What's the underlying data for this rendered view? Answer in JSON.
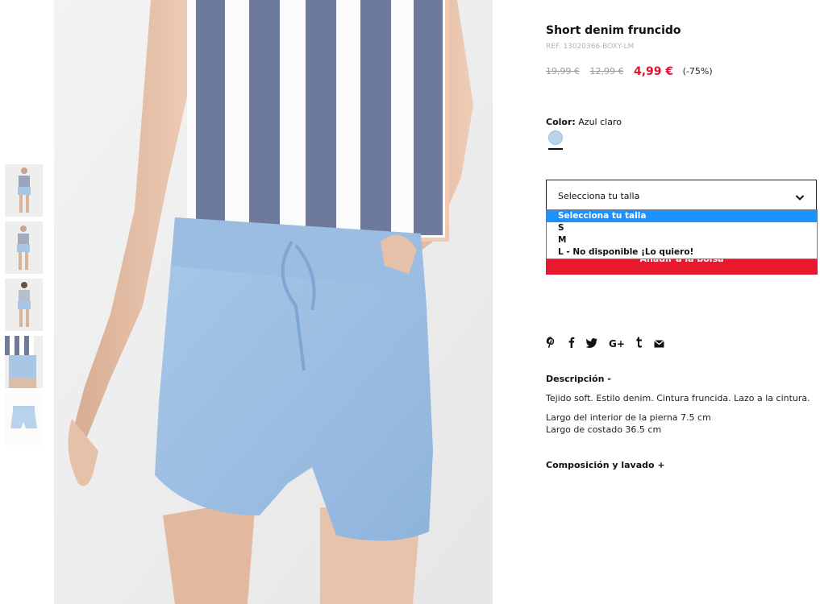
{
  "product": {
    "title": "Short denim fruncido",
    "ref": "REF. 13020366-BOXY-LM",
    "old_price_1": "19,99 €",
    "old_price_2": "12,99 €",
    "price": "4,99 €",
    "discount": "(-75%)"
  },
  "color": {
    "label": "Color:",
    "value": "Azul claro",
    "swatch": "#b8d4ec"
  },
  "size_select": {
    "selected": "Selecciona tu talla",
    "options": [
      "Selecciona tu talla",
      "S",
      "M",
      "L - No disponible ¡Lo quiero!"
    ]
  },
  "add_to_bag": "Añadir a la bolsa",
  "social": [
    "pinterest-icon",
    "facebook-icon",
    "twitter-icon",
    "google-plus-icon",
    "tumblr-icon",
    "email-icon"
  ],
  "description": {
    "heading": "Descripción -",
    "text": "Tejido soft. Estilo denim. Cintura fruncida. Lazo a la cintura.",
    "line1": "Largo del interior de la pierna 7.5 cm",
    "line2": "Largo de costado 36.5 cm"
  },
  "composition": {
    "heading": "Composición y lavado +"
  },
  "colors": {
    "accent_red": "#e8192c",
    "price_red": "#e8102e",
    "select_highlight": "#1e90ff"
  }
}
